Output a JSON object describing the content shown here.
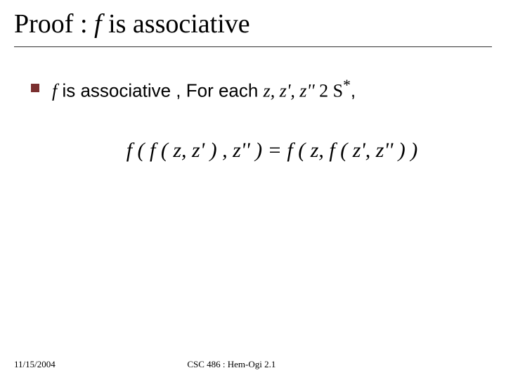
{
  "title": {
    "prefix": "Proof : ",
    "f": "f",
    "suffix": "  is associative"
  },
  "bullet": {
    "f": "f",
    "text1": "  is associative , For each ",
    "vars": "z, z', z'' ",
    "in": "2 ",
    "sigma": "S",
    "star": "*",
    "comma": ","
  },
  "equation": "f ( f ( z, z' ) , z'' ) = f ( z, f ( z', z'' ) )",
  "footer": {
    "date": "11/15/2004",
    "ref": "CSC 486 : Hem-Ogi 2.1"
  }
}
